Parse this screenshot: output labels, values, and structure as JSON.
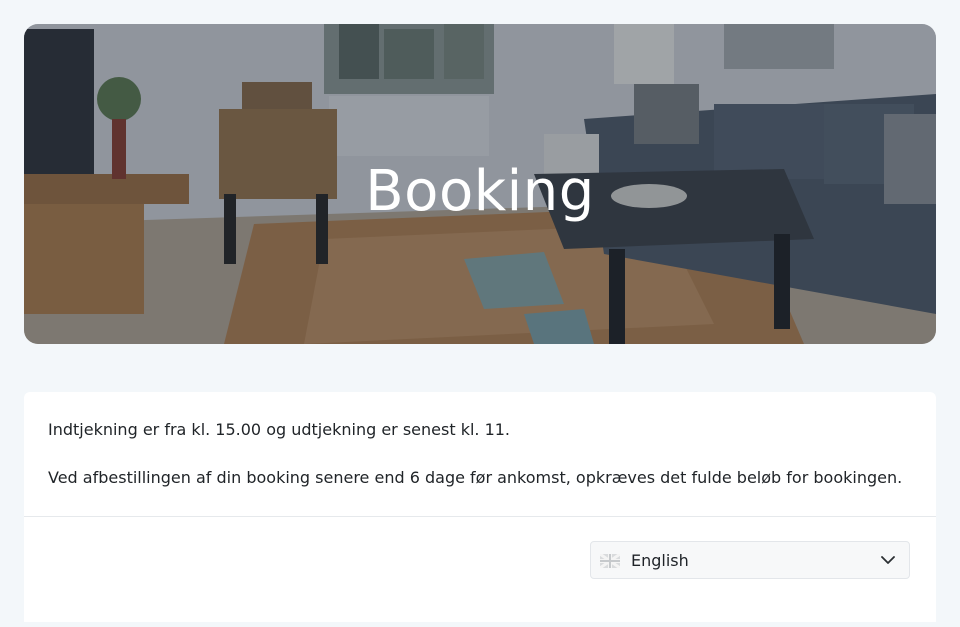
{
  "hero": {
    "title": "Booking"
  },
  "info": {
    "checkin_text": "Indtjekning er fra kl. 15.00 og udtjekning er senest kl. 11.",
    "cancellation_text": "Ved afbestillingen af din booking senere end 6 dage før ankomst, opkræves det fulde beløb for bookingen."
  },
  "language": {
    "selected": "English",
    "flag_icon": "uk-flag-icon",
    "dropdown_icon": "chevron-down-icon"
  },
  "colors": {
    "page_background": "#f3f7fa",
    "card_background": "#ffffff",
    "text": "#212529",
    "hero_title": "#ffffff"
  }
}
